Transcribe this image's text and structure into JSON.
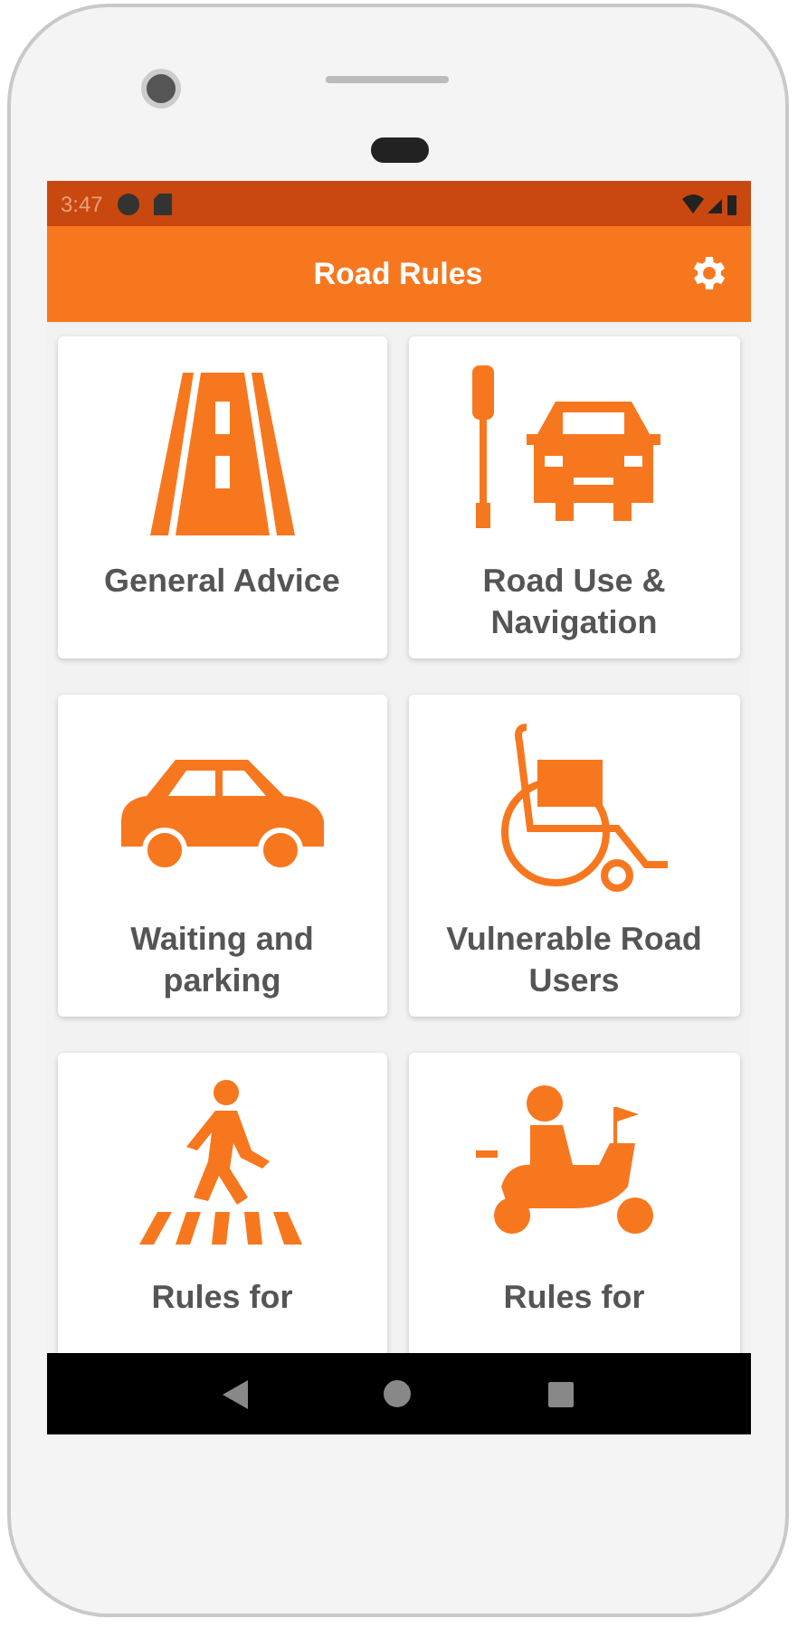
{
  "status_bar": {
    "time": "3:47"
  },
  "app_bar": {
    "title": "Road Rules"
  },
  "tiles": [
    {
      "label": "General Advice"
    },
    {
      "label": "Road Use & Navigation"
    },
    {
      "label": "Waiting and parking"
    },
    {
      "label": "Vulnerable Road Users"
    },
    {
      "label": "Rules for"
    },
    {
      "label": "Rules for"
    }
  ]
}
